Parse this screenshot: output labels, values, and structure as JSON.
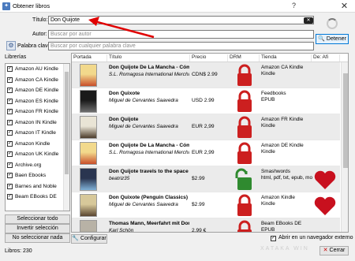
{
  "window": {
    "title": "Obtener libros",
    "help": "?",
    "close": "✕"
  },
  "search": {
    "title_label": "Título:",
    "title_value": "Don Quijote",
    "author_label": "Autor:",
    "author_placeholder": "Buscar por autor",
    "keyword_label": "Palabra clave:",
    "keyword_placeholder": "Buscar por cualquier palabra clave",
    "search_button": "Detener"
  },
  "libraries": {
    "title": "Librerías",
    "items": [
      "Amazon AU Kindle",
      "Amazon CA Kindle",
      "Amazon DE Kindle",
      "Amazon ES Kindle",
      "Amazon FR Kindle",
      "Amazon IN Kindle",
      "Amazon IT Kindle",
      "Amazon Kindle",
      "Amazon UK Kindle",
      "Archive.org",
      "Baen Ebooks",
      "Barnes and Noble",
      "Beam EBooks DE"
    ],
    "select_all": "Seleccionar todo",
    "invert": "Invertir selección",
    "select_none": "No seleccionar nada",
    "configure": "Configurar"
  },
  "results": {
    "columns": [
      "Portada",
      "Título",
      "Precio",
      "DRM",
      "Tienda",
      "De: Afi"
    ],
    "rows": [
      {
        "title": "Don Quijote De La Mancha - Cómic B",
        "author": "S.L. Romagosa International Merchand",
        "price": "CDN$ 2.99",
        "store": "Amazon CA Kindle\nKindle",
        "drm": "locked",
        "affiliate": false
      },
      {
        "title": "Don Quixote",
        "author": "Miguel de Cervantes Saavedra",
        "price": "USD 2.99",
        "store": "Feedbooks\nEPUB",
        "drm": "locked",
        "affiliate": false
      },
      {
        "title": "Don Quijote",
        "author": "Miguel de Cervantes Saavedra",
        "price": "EUR 2,99",
        "store": "Amazon FR Kindle\nKindle",
        "drm": "locked",
        "affiliate": false
      },
      {
        "title": "Don Quijote De La Mancha - Cómic B",
        "author": "S.L. Romagosa International Merchand",
        "price": "EUR 2,99",
        "store": "Amazon DE Kindle\nKindle",
        "drm": "locked",
        "affiliate": false
      },
      {
        "title": "Don Quijote travels to the space",
        "author": "beatriz35",
        "price": "$2.99",
        "store": "Smashwords\nhtml, pdf, txt, epub, mo",
        "drm": "unlocked",
        "affiliate": true
      },
      {
        "title": "Don Quixote (Penguin Classics)",
        "author": "Miguel de Cervantes Saavedra",
        "price": "$2.99",
        "store": "Amazon Kindle\nKindle",
        "drm": "locked",
        "affiliate": true
      },
      {
        "title": "Thomas Mann, Meerfahrt mit Don Q",
        "author": "Karl Schön",
        "price": "2.99 €",
        "store": "Beam EBooks DE\nEPUB",
        "drm": "locked",
        "affiliate": false
      }
    ]
  },
  "footer": {
    "external_browser": "Abrir en un navegador externo",
    "external_checked": true,
    "status": "Libros: 230",
    "close_button": "Cerrar",
    "watermark": "XATAKA WIN"
  },
  "colors": {
    "lock_red": "#cc1f1f",
    "lock_green": "#2f8a2f",
    "heart_red": "#c8101e",
    "accent": "#0078d7"
  }
}
